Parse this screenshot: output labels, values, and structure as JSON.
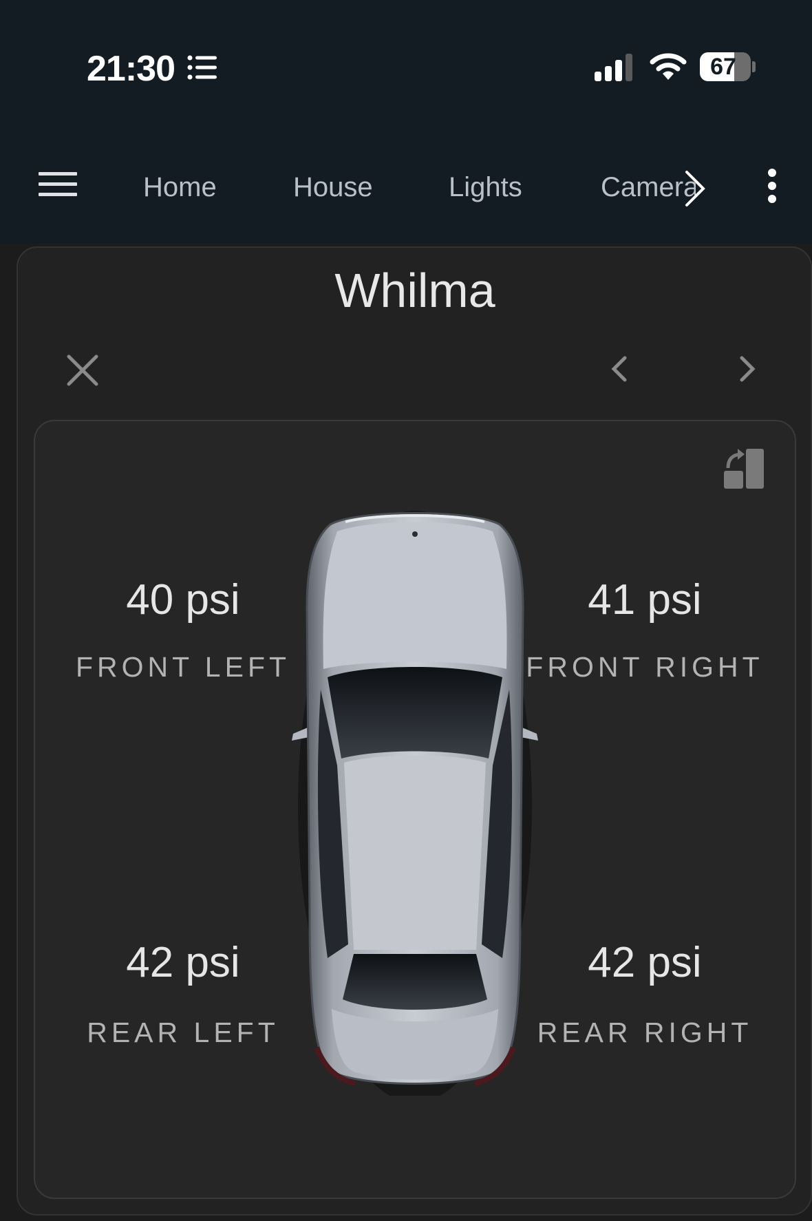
{
  "status_bar": {
    "time": "21:30",
    "battery_level": "67",
    "battery_fraction": 0.67
  },
  "nav": {
    "tabs": [
      {
        "label": "Home"
      },
      {
        "label": "House"
      },
      {
        "label": "Lights"
      },
      {
        "label": "Camera"
      }
    ]
  },
  "dialog": {
    "title": "Whilma"
  },
  "tires": {
    "front_left": {
      "value": "40 psi",
      "label": "FRONT LEFT"
    },
    "front_right": {
      "value": "41 psi",
      "label": "FRONT RIGHT"
    },
    "rear_left": {
      "value": "42 psi",
      "label": "REAR LEFT"
    },
    "rear_right": {
      "value": "42 psi",
      "label": "REAR RIGHT"
    }
  },
  "colors": {
    "topbar": "#141c23",
    "dialog_bg": "#222222",
    "card_bg": "#262626",
    "tab_text": "#b9c0c7",
    "car_body": "#b8bcc4"
  },
  "icons": {
    "status_list": "list-icon",
    "signal": "cellular-signal-icon",
    "wifi": "wifi-icon",
    "menu": "hamburger-menu-icon",
    "tabs_next": "chevron-right-icon",
    "more": "more-vertical-icon",
    "close": "close-icon",
    "prev": "chevron-left-icon",
    "next": "chevron-right-icon",
    "swap": "swap-orientation-icon"
  }
}
